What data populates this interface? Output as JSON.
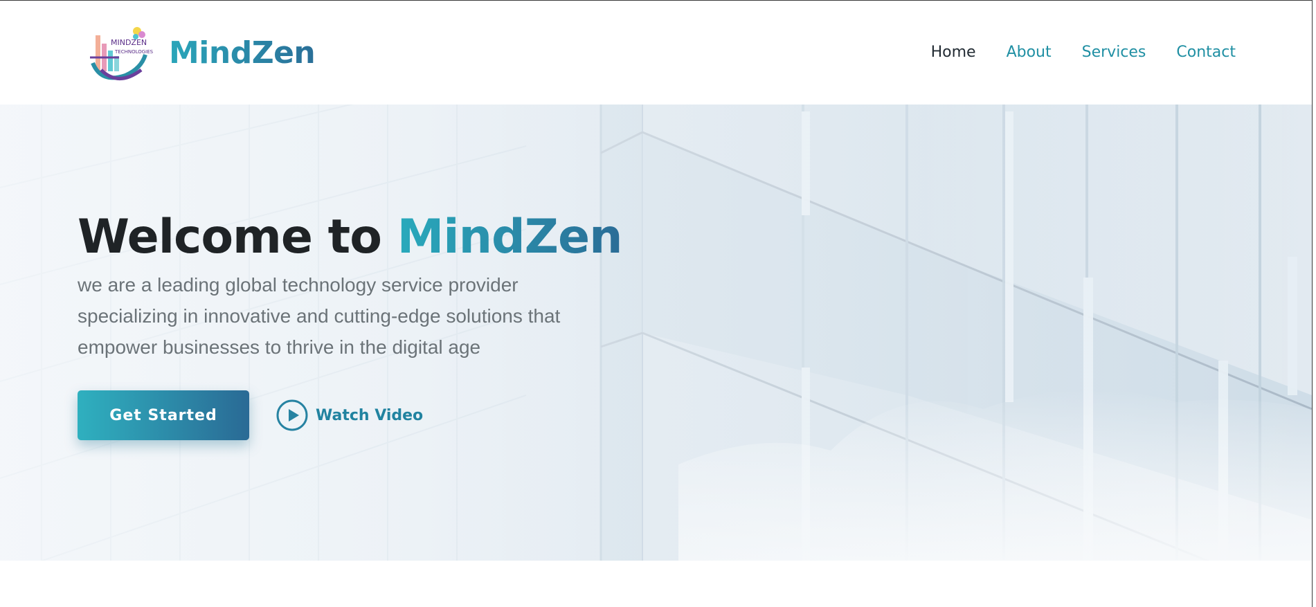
{
  "header": {
    "logo": {
      "line1": "MINDZEN",
      "line2": "TECHNOLOGIES",
      "icon": "mindzen-logo"
    },
    "brand_name": "MindZen",
    "nav": [
      {
        "label": "Home",
        "active": true
      },
      {
        "label": "About",
        "active": false
      },
      {
        "label": "Services",
        "active": false
      },
      {
        "label": "Contact",
        "active": false
      }
    ]
  },
  "hero": {
    "title_prefix": "Welcome to ",
    "title_accent": "MindZen",
    "subtitle": "we are a leading global technology service provider specializing in innovative and cutting-edge solutions that empower businesses to thrive in the digital age",
    "primary_button": "Get Started",
    "video_link": "Watch Video",
    "video_icon": "play-circle-icon",
    "background": "glass-building-facade"
  },
  "colors": {
    "accent_start": "#2aa6ba",
    "accent_end": "#2a6c96",
    "nav_link": "#1f8fa3",
    "nav_active": "#222b33",
    "title": "#1f2326",
    "subtitle": "#6b7378"
  }
}
